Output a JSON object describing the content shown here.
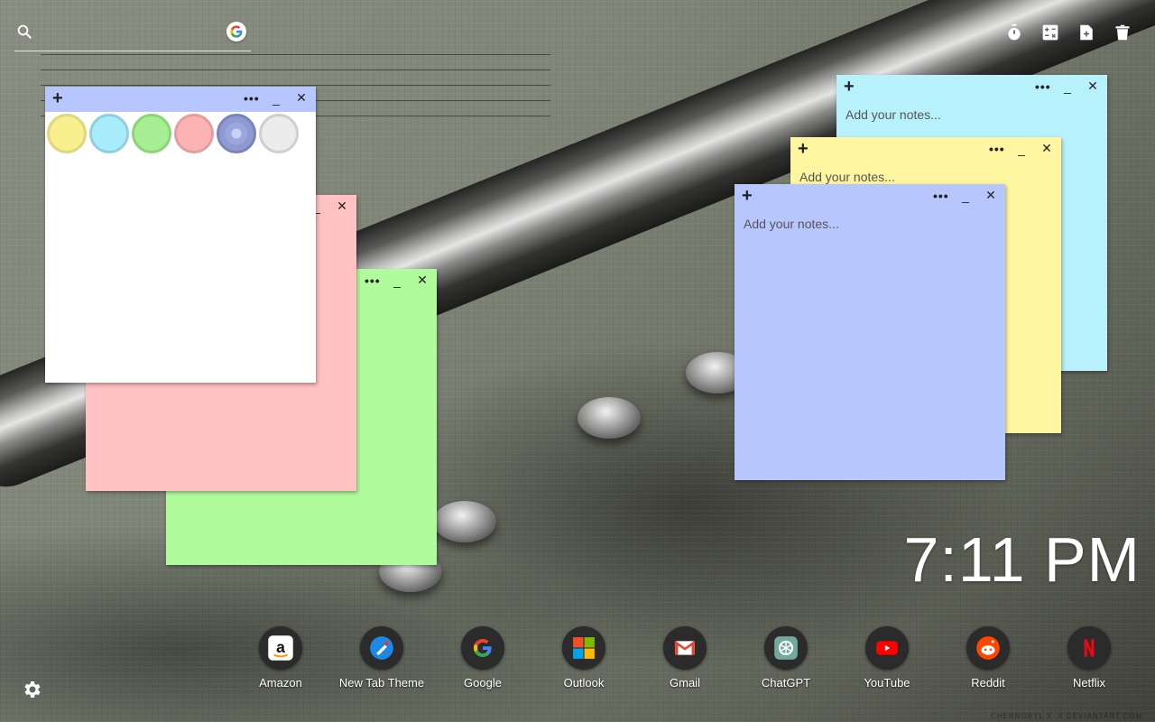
{
  "search": {
    "icon": "search-icon",
    "engine_icon": "google-icon"
  },
  "toolbar": {
    "icons": [
      "timer-icon",
      "calculator-icon",
      "new-note-icon",
      "trash-icon"
    ]
  },
  "colors": {
    "white": "#ffffff",
    "pink": "#ffc1c1",
    "green": "#b0fc9c",
    "blue": "#b8c6fe",
    "yellow": "#fdf59f",
    "cyan": "#b7f2fc",
    "bar_dark": "#7c8bd0"
  },
  "notes": [
    {
      "id": "white",
      "color": "#ffffff",
      "bar": "#b8c6fe",
      "placeholder": ""
    },
    {
      "id": "pink",
      "color": "#ffc1c1",
      "bar": "#ffc1c1",
      "placeholder": ""
    },
    {
      "id": "green",
      "color": "#b0fc9c",
      "bar": "#b0fc9c",
      "placeholder": ""
    },
    {
      "id": "cyan",
      "color": "#b7f2fc",
      "placeholder": "Add your notes..."
    },
    {
      "id": "yellow",
      "color": "#fdf59f",
      "placeholder": "Add your notes..."
    },
    {
      "id": "blue",
      "color": "#b8c6fe",
      "placeholder": "Add your notes..."
    }
  ],
  "note_controls": {
    "add": "+",
    "menu": "•••",
    "minimize": "_",
    "close": "✕"
  },
  "swatches": [
    "#f9ef8e",
    "#a9ecfb",
    "#a6ee91",
    "#fdb3b3",
    "#8e9ad0",
    "#ececec"
  ],
  "clock": "7:11 PM",
  "dock": [
    {
      "label": "Amazon",
      "icon": "amazon-icon"
    },
    {
      "label": "New Tab Theme",
      "icon": "new-tab-theme-icon"
    },
    {
      "label": "Google",
      "icon": "google-icon"
    },
    {
      "label": "Outlook",
      "icon": "outlook-icon"
    },
    {
      "label": "Gmail",
      "icon": "gmail-icon"
    },
    {
      "label": "ChatGPT",
      "icon": "chatgpt-icon"
    },
    {
      "label": "YouTube",
      "icon": "youtube-icon"
    },
    {
      "label": "Reddit",
      "icon": "reddit-icon"
    },
    {
      "label": "Netflix",
      "icon": "netflix-icon"
    }
  ],
  "credit": "CHERNOBYL X .X DEVIANTART.COM"
}
